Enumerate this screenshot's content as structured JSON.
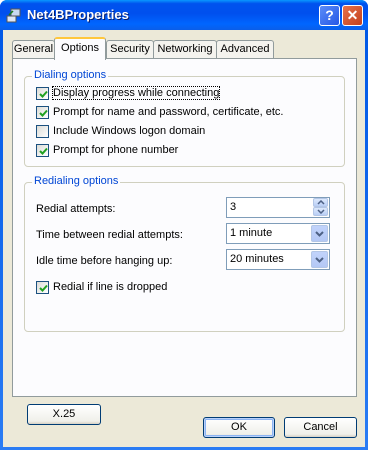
{
  "window": {
    "title": "Net4BProperties",
    "help_label": "?",
    "close_label": "✕"
  },
  "tabs": [
    {
      "label": "General",
      "active": false
    },
    {
      "label": "Options",
      "active": true
    },
    {
      "label": "Security",
      "active": false
    },
    {
      "label": "Networking",
      "active": false
    },
    {
      "label": "Advanced",
      "active": false
    }
  ],
  "dialing": {
    "title": "Dialing options",
    "items": [
      {
        "label": "Display progress while connecting",
        "checked": true
      },
      {
        "label": "Prompt for name and password, certificate, etc.",
        "checked": true
      },
      {
        "label": "Include Windows logon domain",
        "checked": false
      },
      {
        "label": "Prompt for phone number",
        "checked": true
      }
    ]
  },
  "redialing": {
    "title": "Redialing options",
    "attempts_label": "Redial attempts:",
    "attempts_value": "3",
    "between_label": "Time between redial attempts:",
    "between_value": "1 minute",
    "idle_label": "Idle time before hanging up:",
    "idle_value": "20 minutes",
    "redial_drop_label": "Redial if line is dropped",
    "redial_drop_checked": true
  },
  "x25_button": "X.25",
  "ok_button": "OK",
  "cancel_button": "Cancel",
  "colors": {
    "titlebar": "#0054e3",
    "dialog_bg": "#ece9d8",
    "group_title": "#0046d5",
    "check": "#21a121"
  }
}
